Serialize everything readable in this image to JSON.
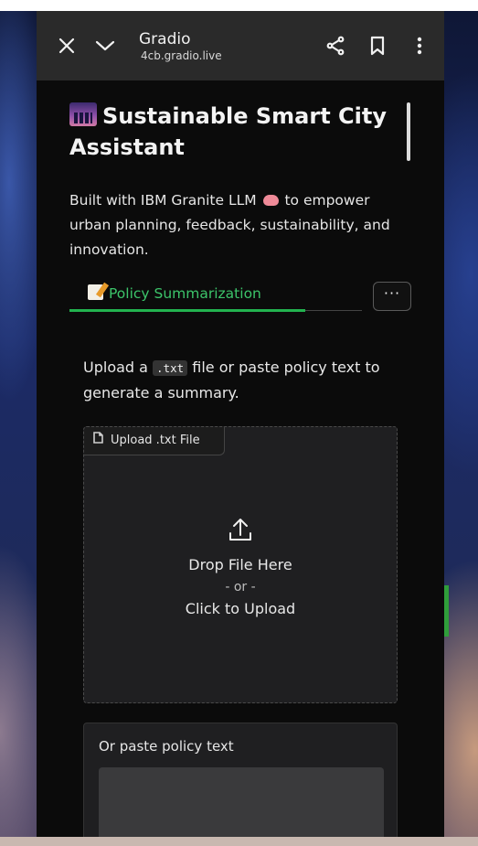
{
  "browser": {
    "site_title": "Gradio",
    "url": "4cb.gradio.live"
  },
  "app": {
    "title": "Sustainable Smart City Assistant",
    "intro_before": "Built with IBM Granite LLM",
    "intro_after": " to empower urban planning, feedback, sustainability, and innovation."
  },
  "tabs": {
    "active_label": "Policy Summarization",
    "more_label": "···"
  },
  "policy": {
    "lead_before": "Upload a ",
    "lead_code": ".txt",
    "lead_after": " file or paste policy text to generate a summary.",
    "upload_label": "Upload .txt File",
    "drop_text": "Drop File Here",
    "or_text": "- or -",
    "click_text": "Click to Upload",
    "paste_label": "Or paste policy text"
  },
  "icons": {
    "close": "close-icon",
    "expand": "chevron-down-icon",
    "share": "share-icon",
    "bookmark": "bookmark-icon",
    "menu": "more-vertical-icon",
    "upload": "upload-icon",
    "file": "file-icon"
  },
  "colors": {
    "accent": "#22b34f",
    "surface": "#1f1f21",
    "background": "#0b0b0b"
  }
}
